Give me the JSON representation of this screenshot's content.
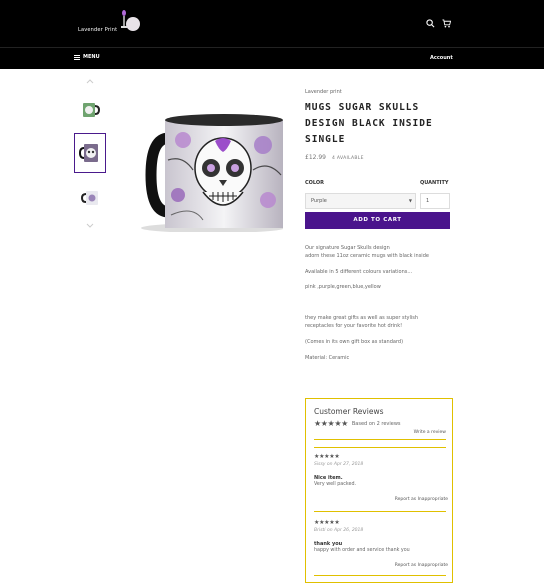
{
  "header": {
    "brand": "Lavender Print",
    "search_icon": "search-icon",
    "cart_icon": "cart-icon"
  },
  "nav": {
    "menu_label": "MENU",
    "account_label": "Account"
  },
  "gallery": {
    "thumbnails": [
      "mug-thumbnail",
      "mug-thumbnail",
      "mug-thumbnail"
    ],
    "active_index": 1
  },
  "product": {
    "vendor": "Lavender print",
    "title": "MUGS SUGAR SKULLS DESIGN BLACK INSIDE SINGLE",
    "price": "£12.99",
    "stock": "4 AVAILABLE",
    "color_label": "COLOR",
    "quantity_label": "QUANTITY",
    "color_value": "Purple",
    "quantity_value": "1",
    "add_to_cart": "ADD TO CART",
    "accent_color": "#4a148c"
  },
  "description": [
    "Our signature Sugar Skulls design",
    "adorn these 11oz ceramic mugs with black inside",
    "Available in 5 different colours variations...",
    "pink ,purple,green,blue,yellow",
    "they make great gifts as well as super stylish",
    "receptacles for your favorite hot drink!",
    "(Comes in its own gift box as standard)",
    "Material: Ceramic"
  ],
  "reviews": {
    "heading": "Customer Reviews",
    "average_stars": "★★★★★",
    "summary": "Based on 2 reviews",
    "write_link": "Write a review",
    "border_color": "#e0c000",
    "items": [
      {
        "stars": "★★★★★",
        "author": "Sissy on Apr 27, 2018",
        "title": "Nice item.",
        "body": "Very well packed.",
        "report": "Report as Inappropriate"
      },
      {
        "stars": "★★★★★",
        "author": "Bristi on Apr 26, 2018",
        "title": "thank you",
        "body": "happy with order and service thank you",
        "report": "Report as Inappropriate"
      }
    ]
  }
}
